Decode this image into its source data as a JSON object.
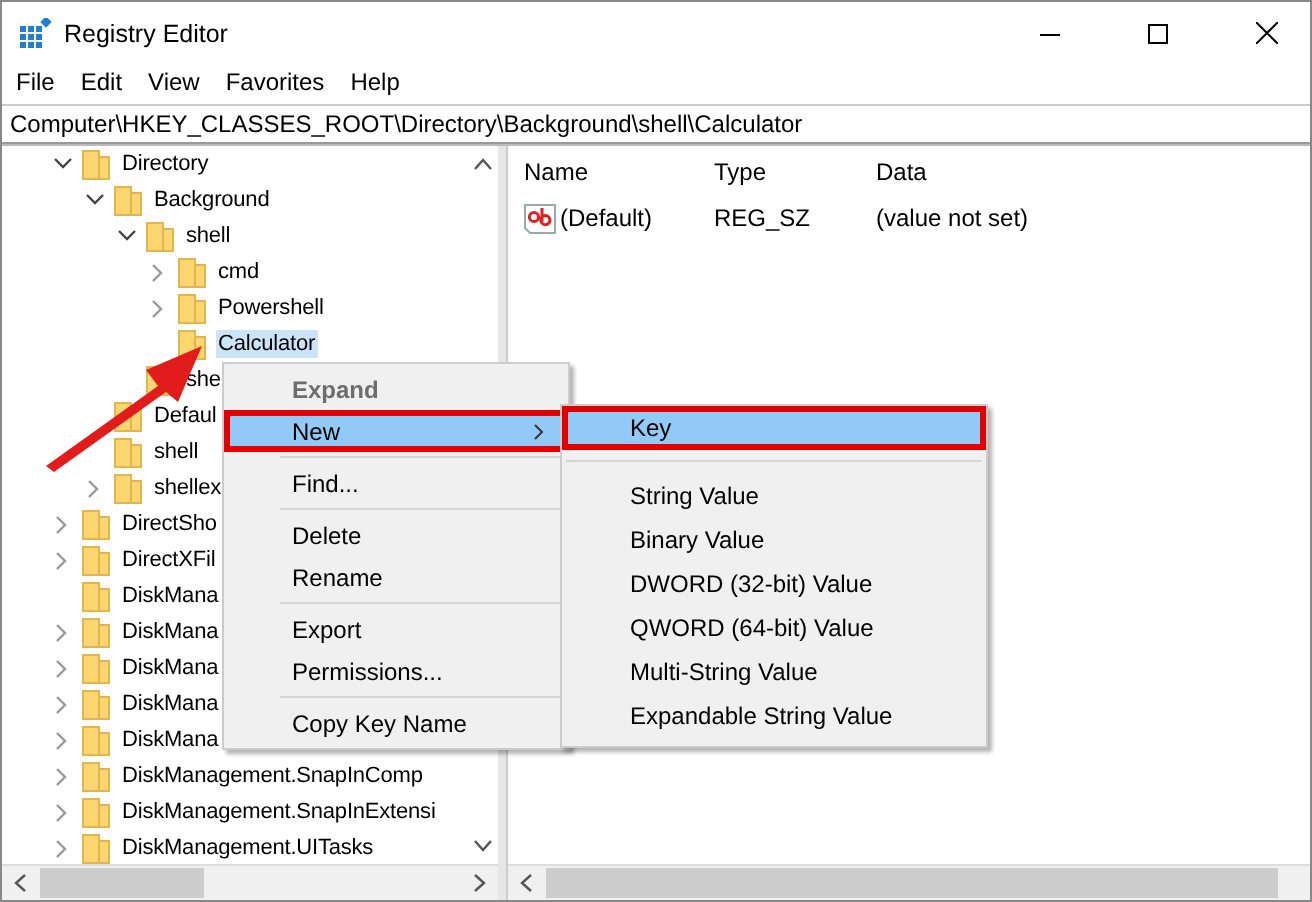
{
  "window": {
    "title": "Registry Editor"
  },
  "menu_bar": [
    "File",
    "Edit",
    "View",
    "Favorites",
    "Help"
  ],
  "address_bar": {
    "value": "Computer\\HKEY_CLASSES_ROOT\\Directory\\Background\\shell\\Calculator"
  },
  "tree": [
    {
      "label": "Directory",
      "expanded": true,
      "selected": false,
      "children": [
        {
          "label": "Background",
          "expanded": true,
          "selected": false,
          "children": [
            {
              "label": "shell",
              "expanded": true,
              "selected": false,
              "children": [
                {
                  "label": "cmd",
                  "expanded": false,
                  "selected": false
                },
                {
                  "label": "Powershell",
                  "expanded": false,
                  "selected": false
                },
                {
                  "label": "Calculator",
                  "selected": true
                }
              ]
            },
            {
              "label": "she",
              "selected": false
            }
          ]
        },
        {
          "label": "Defaul",
          "selected": false
        },
        {
          "label": "shell",
          "selected": false
        },
        {
          "label": "shellex",
          "expanded": false,
          "selected": false
        }
      ]
    },
    {
      "label": "DirectSho",
      "expanded": false,
      "selected": false
    },
    {
      "label": "DirectXFil",
      "expanded": false,
      "selected": false
    },
    {
      "label": "DiskMana",
      "selected": false
    },
    {
      "label": "DiskMana",
      "expanded": false,
      "selected": false
    },
    {
      "label": "DiskMana",
      "expanded": false,
      "selected": false
    },
    {
      "label": "DiskMana",
      "expanded": false,
      "selected": false
    },
    {
      "label": "DiskMana",
      "expanded": false,
      "selected": false
    },
    {
      "label": "DiskManagement.SnapInComp",
      "expanded": false,
      "selected": false
    },
    {
      "label": "DiskManagement.SnapInExtensi",
      "expanded": false,
      "selected": false
    },
    {
      "label": "DiskManagement.UITasks",
      "expanded": false,
      "selected": false
    }
  ],
  "values_table": {
    "columns": [
      "Name",
      "Type",
      "Data"
    ],
    "rows": [
      {
        "name": "(Default)",
        "type": "REG_SZ",
        "data": "(value not set)"
      }
    ]
  },
  "context_menu": [
    {
      "kind": "item",
      "label": "Expand",
      "disabled": true,
      "default": true,
      "selected": false,
      "submenu": false,
      "annotated": false
    },
    {
      "kind": "item",
      "label": "New",
      "disabled": false,
      "default": false,
      "selected": true,
      "submenu": true,
      "annotated": true
    },
    {
      "kind": "separator"
    },
    {
      "kind": "item",
      "label": "Find...",
      "disabled": false,
      "default": false,
      "selected": false,
      "submenu": false,
      "annotated": false
    },
    {
      "kind": "separator"
    },
    {
      "kind": "item",
      "label": "Delete",
      "disabled": false,
      "default": false,
      "selected": false,
      "submenu": false,
      "annotated": false
    },
    {
      "kind": "item",
      "label": "Rename",
      "disabled": false,
      "default": false,
      "selected": false,
      "submenu": false,
      "annotated": false
    },
    {
      "kind": "separator"
    },
    {
      "kind": "item",
      "label": "Export",
      "disabled": false,
      "default": false,
      "selected": false,
      "submenu": false,
      "annotated": false
    },
    {
      "kind": "item",
      "label": "Permissions...",
      "disabled": false,
      "default": false,
      "selected": false,
      "submenu": false,
      "annotated": false
    },
    {
      "kind": "separator"
    },
    {
      "kind": "item",
      "label": "Copy Key Name",
      "disabled": false,
      "default": false,
      "selected": false,
      "submenu": false,
      "annotated": false
    }
  ],
  "submenu": [
    {
      "kind": "item",
      "label": "Key",
      "selected": true,
      "annotated": true
    },
    {
      "kind": "separator"
    },
    {
      "kind": "item",
      "label": "String Value",
      "selected": false,
      "annotated": false
    },
    {
      "kind": "item",
      "label": "Binary Value",
      "selected": false,
      "annotated": false
    },
    {
      "kind": "item",
      "label": "DWORD (32-bit) Value",
      "selected": false,
      "annotated": false
    },
    {
      "kind": "item",
      "label": "QWORD (64-bit) Value",
      "selected": false,
      "annotated": false
    },
    {
      "kind": "item",
      "label": "Multi-String Value",
      "selected": false,
      "annotated": false
    },
    {
      "kind": "item",
      "label": "Expandable String Value",
      "selected": false,
      "annotated": false
    }
  ]
}
